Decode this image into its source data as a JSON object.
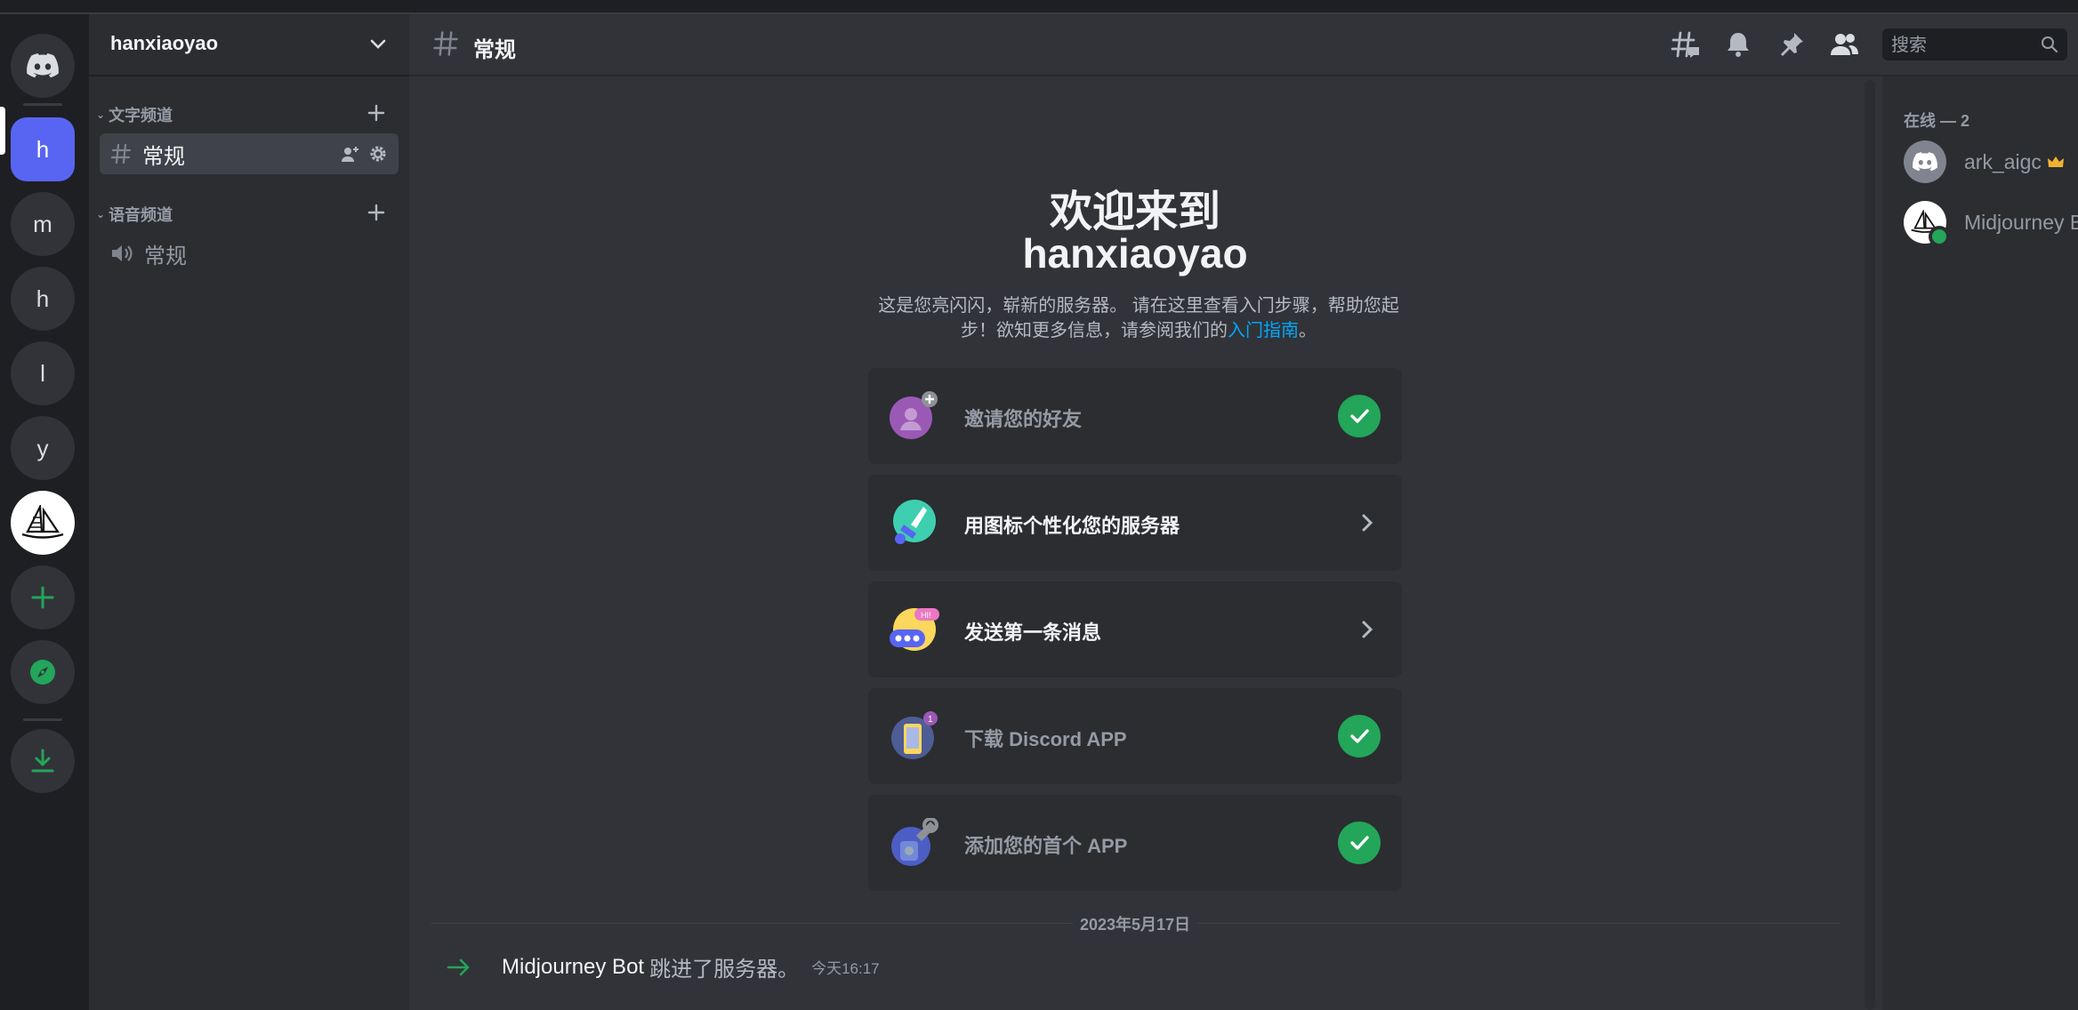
{
  "colors": {
    "brand": "#5865f2",
    "success": "#23a55a",
    "link": "#00a8fc",
    "bg_main": "#313338",
    "bg_sidebar": "#2b2d31",
    "bg_rail": "#1e1f22"
  },
  "rail": {
    "home_icon": "discord-logo-icon",
    "servers": [
      {
        "letter": "h",
        "active": true
      },
      {
        "letter": "m"
      },
      {
        "letter": "h"
      },
      {
        "letter": "l"
      },
      {
        "letter": "y"
      }
    ],
    "midjourney_icon": "sailboat-icon",
    "add_icon": "plus-icon",
    "explore_icon": "compass-icon",
    "download_icon": "download-icon"
  },
  "sidebar": {
    "guild_name": "hanxiaoyao",
    "text_category": "文字频道",
    "voice_category": "语音频道",
    "text_channel": "常规",
    "voice_channel": "常规"
  },
  "header": {
    "channel_name": "常规",
    "search_placeholder": "搜索",
    "icons": [
      "threads-icon",
      "bell-icon",
      "pin-icon",
      "members-icon"
    ]
  },
  "welcome": {
    "line1": "欢迎来到",
    "line2": "hanxiaoyao",
    "intro": "这是您亮闪闪，崭新的服务器。 请在这里查看入门步骤，帮助您起步！欲知更多信息，请参阅我们的",
    "intro_link": "入门指南",
    "intro_end": "。"
  },
  "cards": [
    {
      "label": "邀请您的好友",
      "done": true,
      "icon": "invite-friends-icon"
    },
    {
      "label": "用图标个性化您的服务器",
      "done": false,
      "icon": "paintbrush-icon"
    },
    {
      "label": "发送第一条消息",
      "done": false,
      "icon": "chat-bubble-icon"
    },
    {
      "label": "下载 Discord APP",
      "done": true,
      "icon": "mobile-app-icon"
    },
    {
      "label": "添加您的首个 APP",
      "done": true,
      "icon": "wrench-icon"
    }
  ],
  "messages": {
    "date": "2023年5月17日",
    "system": {
      "user": "Midjourney Bot",
      "text": "跳进了服务器。",
      "time": "今天16:17"
    }
  },
  "members": {
    "header": "在线 — 2",
    "list": [
      {
        "name": "ark_aigc",
        "owner": true
      },
      {
        "name": "Midjourney Bot",
        "online": true
      }
    ]
  }
}
